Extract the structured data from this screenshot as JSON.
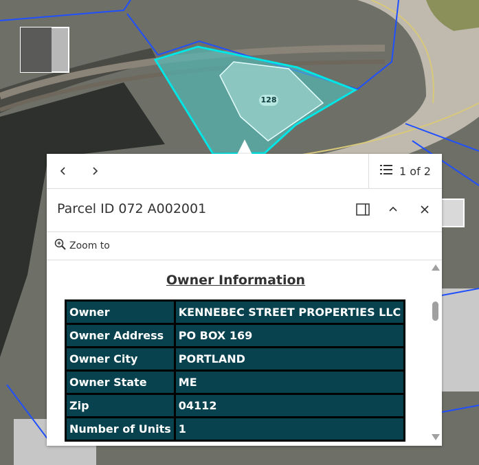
{
  "map": {
    "parcel_label": "128"
  },
  "popup": {
    "nav": {
      "prev_icon": "chevron-left-icon",
      "next_icon": "chevron-right-icon",
      "list_icon": "list-icon",
      "counter": "1 of 2"
    },
    "header": {
      "title": "Parcel ID 072 A002001",
      "dock_icon": "dock-side-icon",
      "collapse_icon": "chevron-up-icon",
      "close_icon": "close-icon"
    },
    "actions": {
      "zoom_label": "Zoom to",
      "zoom_icon": "zoom-in-icon"
    },
    "content": {
      "section_title": "Owner Information",
      "rows": [
        {
          "label": "Owner",
          "value": "KENNEBEC STREET PROPERTIES LLC"
        },
        {
          "label": "Owner Address",
          "value": "PO BOX 169"
        },
        {
          "label": "Owner City",
          "value": "PORTLAND"
        },
        {
          "label": "Owner State",
          "value": "ME"
        },
        {
          "label": "Zip",
          "value": "04112"
        },
        {
          "label": "Number of Units",
          "value": "1"
        }
      ]
    }
  },
  "colors": {
    "parcel_outline": "#00e5e5",
    "parcel_fill": "#4fc2c0",
    "parcel_lines": "#1f4fff",
    "table_cell": "#08424e"
  }
}
